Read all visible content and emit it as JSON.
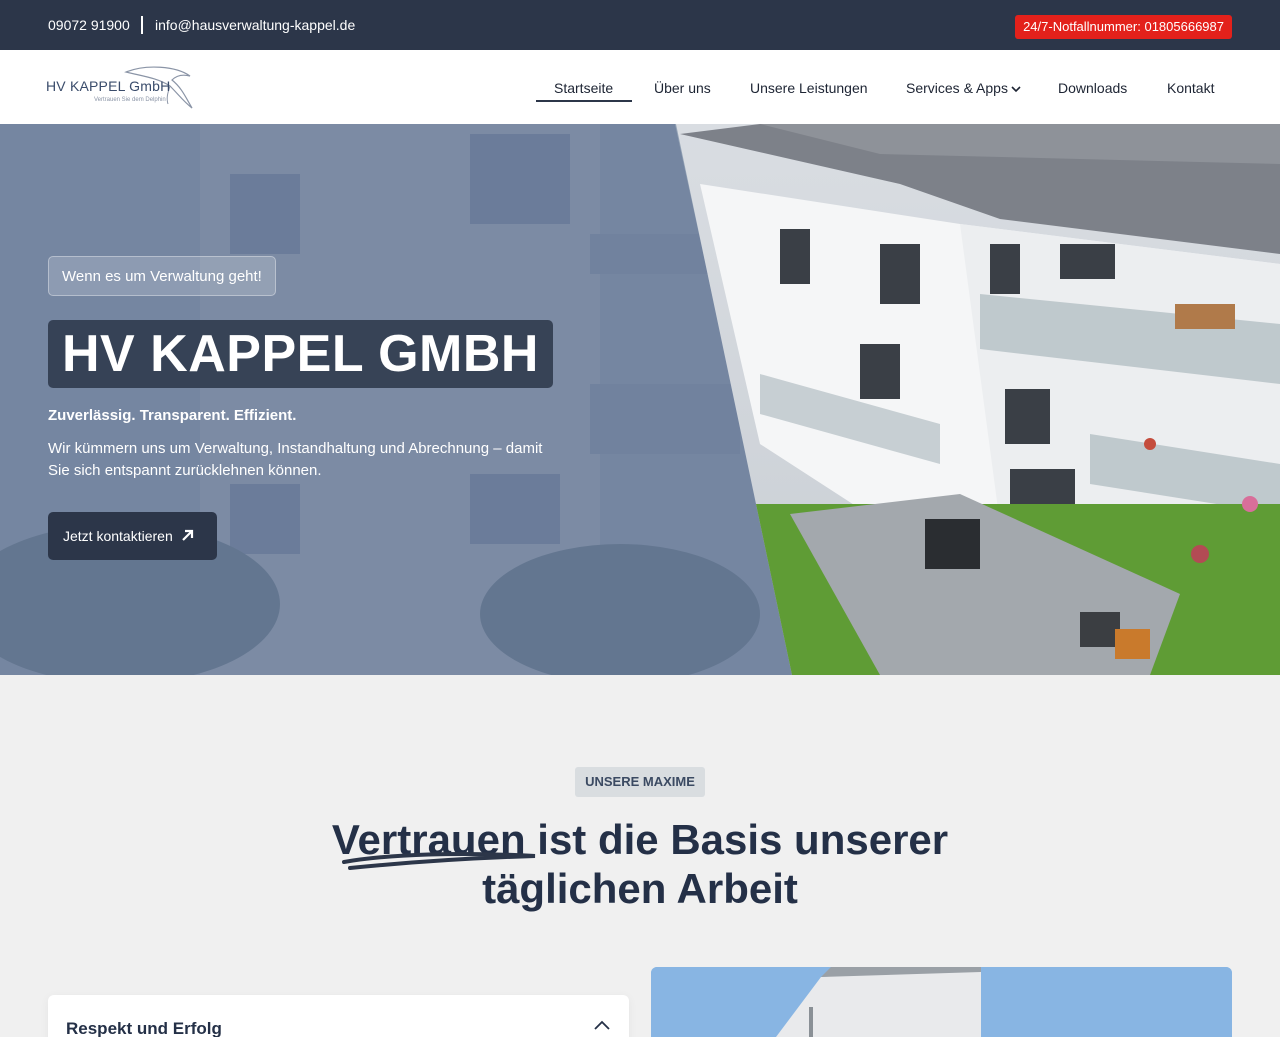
{
  "topbar": {
    "phone": "09072 91900",
    "email": "info@hausverwaltung-kappel.de",
    "emergency": "24/7-Notfallnummer: 01805666987",
    "colors": {
      "bar": "#2c3649",
      "emergency": "#e3211b"
    }
  },
  "header": {
    "logo_text": "HV KAPPEL GmbH",
    "logo_sub": "Vertrauen Sie dem Delphin",
    "nav": [
      {
        "label": "Startseite",
        "active": true
      },
      {
        "label": "Über uns"
      },
      {
        "label": "Unsere Leistungen"
      },
      {
        "label": "Services & Apps",
        "dropdown": true
      },
      {
        "label": "Downloads"
      },
      {
        "label": "Kontakt"
      }
    ]
  },
  "hero": {
    "badge": "Wenn es um Verwaltung geht!",
    "title": "HV KAPPEL GMBH",
    "tagline": "Zuverlässig. Transparent. Effizient.",
    "description": "Wir kümmern uns um Verwaltung, Instandhaltung und Abrechnung – damit Sie sich entspannt zurücklehnen können.",
    "cta": "Jetzt kontaktieren",
    "cta_icon": "arrow-up-right-icon"
  },
  "maxime": {
    "badge": "UNSERE MAXIME",
    "title_highlight": "Vertrauen",
    "title_rest": " ist die Basis unserer täglichen Arbeit"
  },
  "accordion": {
    "items": [
      {
        "title": "Respekt und Erfolg",
        "expanded": true
      }
    ]
  }
}
